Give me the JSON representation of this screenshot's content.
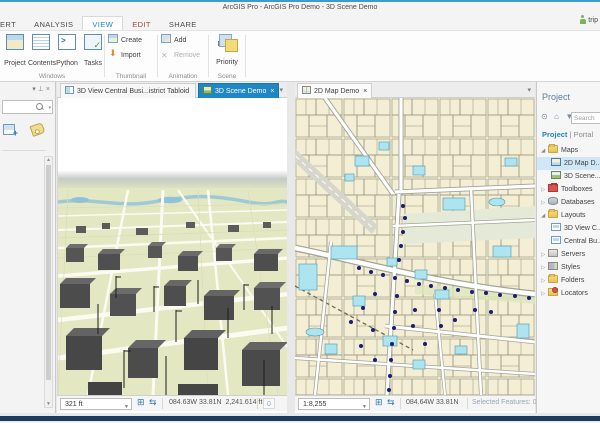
{
  "window": {
    "title": "ArcGIS Pro - ArcGIS Pro Demo - 3D Scene Demo",
    "user_name": "trip"
  },
  "ribbon_tabs": {
    "insert_cut": "ERT",
    "analysis": "ANALYSIS",
    "view": "VIEW",
    "edit": "EDIT",
    "share": "SHARE"
  },
  "ribbon": {
    "windows_group": {
      "label": "Windows",
      "project": "Project",
      "contents": "Contents",
      "python": "Python",
      "tasks": "Tasks"
    },
    "thumbnail_group": {
      "label": "Thumbnail",
      "create": "Create",
      "import": "Import"
    },
    "animation_group": {
      "label": "Animation",
      "add": "Add",
      "remove": "Remove"
    },
    "scene_group": {
      "label": "Scene",
      "depth_priority": "Depth Priority"
    }
  },
  "view_tabs": {
    "tab_layout": "3D View Central Busi...istrict Tabloid",
    "tab_scene": "3D Scene Demo",
    "tab_map": "2D Map Demo",
    "close_glyph": "×"
  },
  "scene_status": {
    "scale": "321 ft",
    "coords": "084.63W 33.81N",
    "elevation": "2,241.614 ft",
    "badge": "0"
  },
  "map_status": {
    "scale": "1:8,255",
    "coords": "084.64W 33.81N",
    "selected": "Selected Features: 0"
  },
  "project_pane": {
    "title": "Project",
    "search_placeholder": "Search",
    "tab_project": "Project",
    "tab_divider": "|",
    "tab_portal": "Portal",
    "tree": {
      "maps": "Maps",
      "map2d": "2D Map D...",
      "scene3d": "3D Scene...",
      "toolboxes": "Toolboxes",
      "databases": "Databases",
      "layouts": "Layouts",
      "layout_3dview": "3D View C...",
      "layout_central": "Central Bu...",
      "servers": "Servers",
      "styles": "Styles",
      "folders": "Folders",
      "locators": "Locators"
    }
  },
  "colors": {
    "accent_blue": "#1e87c4",
    "edit_tab_red": "#9c4a3c",
    "map_beige": "#f4eed4",
    "water_cyan": "#aee4f0",
    "point_navy": "#1c1c70",
    "ground_green": "#e3e7c2",
    "building_gray": "#4f4f4f",
    "bottom_bar_navy": "#1d3a5f"
  }
}
